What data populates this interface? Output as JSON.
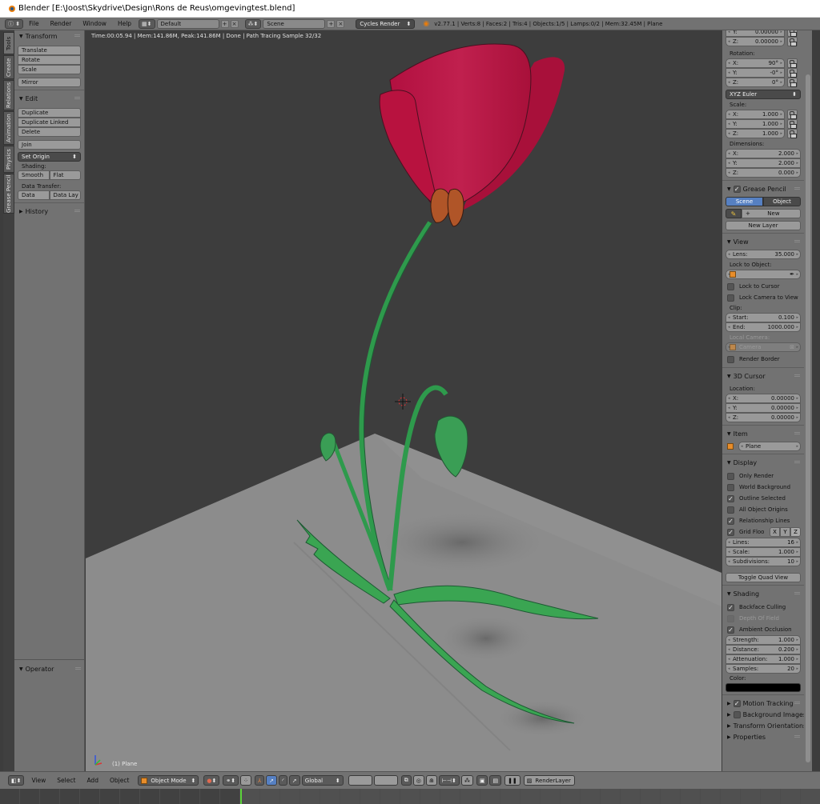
{
  "window": {
    "title": "Blender [E:\\Joost\\Skydrive\\Design\\Rons de Reus\\omgevingtest.blend]"
  },
  "infobar": {
    "menus": [
      "File",
      "Render",
      "Window",
      "Help"
    ],
    "screen_layout": "Default",
    "scene": "Scene",
    "render_engine": "Cycles Render",
    "stats": "v2.77.1 | Verts:8 | Faces:2 | Tris:4 | Objects:1/5 | Lamps:0/2 | Mem:32.45M | Plane"
  },
  "tool_tabs": [
    "Tools",
    "Create",
    "Relations",
    "Animation",
    "Physics",
    "Grease Pencil"
  ],
  "toolshelf": {
    "transform": {
      "title": "Transform",
      "buttons": [
        "Translate",
        "Rotate",
        "Scale"
      ],
      "mirror": "Mirror"
    },
    "edit": {
      "title": "Edit",
      "buttons": [
        "Duplicate",
        "Duplicate Linked",
        "Delete"
      ],
      "join": "Join",
      "set_origin": "Set Origin",
      "shading_label": "Shading:",
      "shading_buttons": [
        "Smooth",
        "Flat"
      ],
      "data_transfer_label": "Data Transfer:",
      "data_transfer_buttons": [
        "Data",
        "Data Lay"
      ]
    },
    "history": {
      "title": "History"
    },
    "operator": {
      "title": "Operator"
    }
  },
  "viewport": {
    "render_info": "Time:00:05.94 | Mem:141.86M, Peak:141.86M | Done | Path Tracing Sample 32/32",
    "object_label": "(1) Plane",
    "colors": {
      "background": "#3d3d3d",
      "ground": "#8c8c8c",
      "petal": "#b8123f",
      "sepal": "#b05528",
      "stem": "#2e9a4c",
      "leaf": "#3aa552"
    }
  },
  "properties": {
    "location_partial": {
      "y_value": "0.00000",
      "z_label": "Z:",
      "z_value": "0.00000"
    },
    "rotation": {
      "label": "Rotation:",
      "fields": [
        {
          "axis": "X:",
          "value": "90°"
        },
        {
          "axis": "Y:",
          "value": "-0°"
        },
        {
          "axis": "Z:",
          "value": "0°"
        }
      ],
      "mode": "XYZ Euler"
    },
    "scale": {
      "label": "Scale:",
      "fields": [
        {
          "axis": "X:",
          "value": "1.000"
        },
        {
          "axis": "Y:",
          "value": "1.000"
        },
        {
          "axis": "Z:",
          "value": "1.000"
        }
      ]
    },
    "dimensions": {
      "label": "Dimensions:",
      "fields": [
        {
          "axis": "X:",
          "value": "2.000"
        },
        {
          "axis": "Y:",
          "value": "2.000"
        },
        {
          "axis": "Z:",
          "value": "0.000"
        }
      ]
    },
    "grease_pencil": {
      "title": "Grease Pencil",
      "enabled": true,
      "tabs": [
        "Scene",
        "Object"
      ],
      "active_tab": "Scene",
      "new": "New",
      "new_layer": "New Layer"
    },
    "view": {
      "title": "View",
      "lens_label": "Lens:",
      "lens_value": "35.000",
      "lock_to_object_label": "Lock to Object:",
      "lock_to_cursor": {
        "label": "Lock to Cursor",
        "checked": false
      },
      "lock_camera_to_view": {
        "label": "Lock Camera to View",
        "checked": false
      },
      "clip_label": "Clip:",
      "clip_start_label": "Start:",
      "clip_start": "0.100",
      "clip_end_label": "End:",
      "clip_end": "1000.000",
      "local_camera_label": "Local Camera:",
      "local_camera_value": "Camera",
      "render_border": {
        "label": "Render Border",
        "checked": false
      }
    },
    "cursor": {
      "title": "3D Cursor",
      "location_label": "Location:",
      "fields": [
        {
          "axis": "X:",
          "value": "0.00000"
        },
        {
          "axis": "Y:",
          "value": "0.00000"
        },
        {
          "axis": "Z:",
          "value": "0.00000"
        }
      ]
    },
    "item": {
      "title": "Item",
      "name": "Plane"
    },
    "display": {
      "title": "Display",
      "checks": [
        {
          "label": "Only Render",
          "checked": false
        },
        {
          "label": "World Background",
          "checked": false
        },
        {
          "label": "Outline Selected",
          "checked": true
        },
        {
          "label": "All Object Origins",
          "checked": false
        },
        {
          "label": "Relationship Lines",
          "checked": true
        }
      ],
      "grid_floor": {
        "label": "Grid Floo",
        "checked": true,
        "axes": [
          "X",
          "Y",
          "Z"
        ]
      },
      "lines_label": "Lines:",
      "lines": "16",
      "scale_label": "Scale:",
      "scale": "1.000",
      "subdivisions_label": "Subdivisions:",
      "subdivisions": "10",
      "toggle_quad": "Toggle Quad View"
    },
    "shading": {
      "title": "Shading",
      "backface_culling": {
        "label": "Backface Culling",
        "checked": true
      },
      "depth_of_field": {
        "label": "Depth Of Field",
        "checked": false
      },
      "ambient_occlusion": {
        "label": "Ambient Occlusion",
        "checked": true
      },
      "fields": [
        {
          "label": "Strength:",
          "value": "1.000"
        },
        {
          "label": "Distance:",
          "value": "0.200"
        },
        {
          "label": "Attenuation:",
          "value": "1.000"
        },
        {
          "label": "Samples:",
          "value": "20"
        }
      ],
      "color_label": "Color:",
      "color": "#000000"
    },
    "collapsed_panels": [
      {
        "label": "Motion Tracking",
        "checkbox": true,
        "checked": true
      },
      {
        "label": "Background Images",
        "checkbox": true,
        "checked": false
      },
      {
        "label": "Transform Orientations",
        "checkbox": false
      },
      {
        "label": "Properties",
        "checkbox": false
      }
    ]
  },
  "footer": {
    "menus": [
      "View",
      "Select",
      "Add",
      "Object"
    ],
    "mode": "Object Mode",
    "orientation": "Global",
    "render_layer": "RenderLayer"
  }
}
